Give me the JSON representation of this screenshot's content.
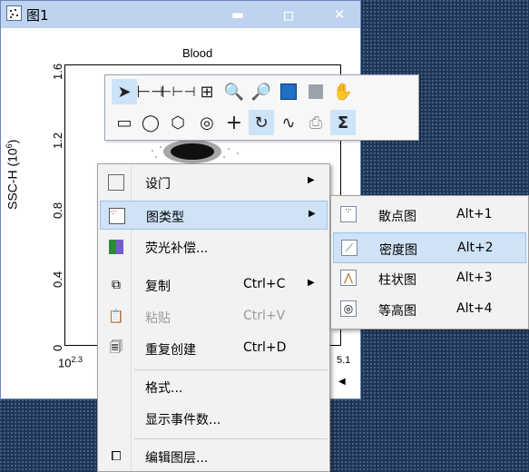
{
  "window": {
    "title": "图1",
    "minimize": "▬",
    "maximize": "▫",
    "close": "✕"
  },
  "plot": {
    "title": "Blood",
    "y_label_main": "SSC-H (10",
    "y_label_sup": "6",
    "y_label_end": ")",
    "y_ticks": [
      "0",
      "0.4",
      "0.8",
      "1.2",
      "1.6"
    ],
    "x_tick_base": "10",
    "x_tick_sup": "2.3",
    "x_tick_right": "5.1"
  },
  "menu": {
    "items": [
      {
        "label": "设门",
        "shortcut": "",
        "has_submenu": true,
        "highlighted": false,
        "disabled": false
      },
      {
        "label": "图类型",
        "shortcut": "",
        "has_submenu": true,
        "highlighted": true,
        "disabled": false
      },
      {
        "label": "荧光补偿...",
        "shortcut": "",
        "has_submenu": false,
        "highlighted": false,
        "disabled": false
      },
      {
        "label": "复制",
        "shortcut": "Ctrl+C",
        "has_submenu": true,
        "highlighted": false,
        "disabled": false
      },
      {
        "label": "粘贴",
        "shortcut": "Ctrl+V",
        "has_submenu": false,
        "highlighted": false,
        "disabled": true
      },
      {
        "label": "重复创建",
        "shortcut": "Ctrl+D",
        "has_submenu": false,
        "highlighted": false,
        "disabled": false
      },
      {
        "label": "格式...",
        "shortcut": "",
        "has_submenu": false,
        "highlighted": false,
        "disabled": false
      },
      {
        "label": "显示事件数...",
        "shortcut": "",
        "has_submenu": false,
        "highlighted": false,
        "disabled": false
      },
      {
        "label": "编辑图层...",
        "shortcut": "",
        "has_submenu": false,
        "highlighted": false,
        "disabled": false
      }
    ]
  },
  "submenu": {
    "items": [
      {
        "label": "散点图",
        "shortcut": "Alt+1",
        "highlighted": false
      },
      {
        "label": "密度图",
        "shortcut": "Alt+2",
        "highlighted": true
      },
      {
        "label": "柱状图",
        "shortcut": "Alt+3",
        "highlighted": false
      },
      {
        "label": "等高图",
        "shortcut": "Alt+4",
        "highlighted": false
      }
    ]
  },
  "toolbar": {
    "row1": [
      "pointer-icon",
      "horizontal-range-icon",
      "bi-range-icon",
      "quadrant-icon",
      "zoom-in-icon",
      "zoom-out-icon",
      "fit-icon",
      "full-icon",
      "hand-icon"
    ],
    "row2": [
      "rectangle-gate-icon",
      "ellipse-gate-icon",
      "polygon-gate-icon",
      "contour-gate-icon",
      "crosshair-icon",
      "refresh-icon",
      "spline-icon",
      "printer-icon",
      "sigma-icon"
    ]
  },
  "colors": {
    "accent": "#cfe2f6",
    "title_bar": "#bfd2ef",
    "desktop": "#1e3557"
  }
}
